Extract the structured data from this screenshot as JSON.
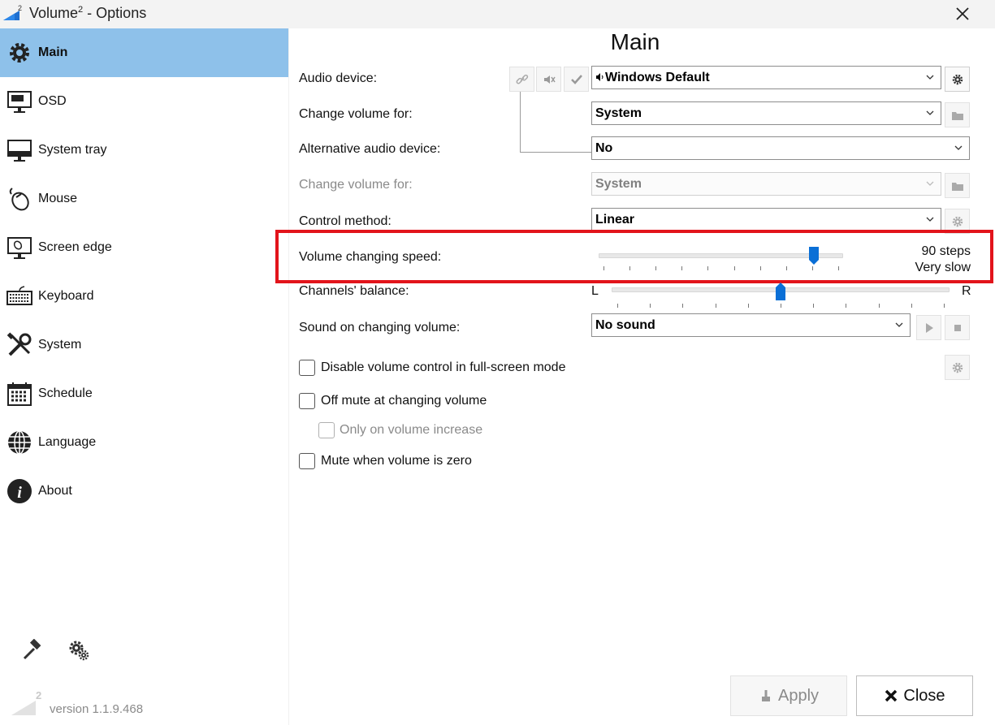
{
  "window": {
    "title": "Volume",
    "title_superscript": "2",
    "title_suffix": " - Options"
  },
  "sidebar": {
    "items": [
      {
        "label": "Main",
        "icon": "gear-icon",
        "active": true
      },
      {
        "label": "OSD",
        "icon": "monitor-icon"
      },
      {
        "label": "System tray",
        "icon": "system-tray-icon"
      },
      {
        "label": "Mouse",
        "icon": "mouse-icon"
      },
      {
        "label": "Screen edge",
        "icon": "screen-edge-icon"
      },
      {
        "label": "Keyboard",
        "icon": "keyboard-icon"
      },
      {
        "label": "System",
        "icon": "tools-icon"
      },
      {
        "label": "Schedule",
        "icon": "calendar-icon"
      },
      {
        "label": "Language",
        "icon": "globe-icon"
      },
      {
        "label": "About",
        "icon": "info-icon"
      }
    ],
    "version": "version 1.1.9.468"
  },
  "main": {
    "title": "Main",
    "audio_device": {
      "label": "Audio device:",
      "value": "Windows Default"
    },
    "change_volume_for": {
      "label": "Change volume for:",
      "value": "System"
    },
    "alt_audio_device": {
      "label": "Alternative audio device:",
      "value": "No"
    },
    "change_volume_for_alt": {
      "label": "Change volume for:",
      "value": "System"
    },
    "control_method": {
      "label": "Control method:",
      "value": "Linear"
    },
    "volume_speed": {
      "label": "Volume changing speed:",
      "steps": "90 steps",
      "speed_text": "Very slow",
      "position": 0.88
    },
    "balance": {
      "label": "Channels' balance:",
      "left": "L",
      "right": "R",
      "position": 0.5
    },
    "sound_on_change": {
      "label": "Sound on changing volume:",
      "value": "No sound"
    },
    "checkboxes": [
      {
        "label": "Disable volume control in full-screen mode",
        "checked": false,
        "enabled": true
      },
      {
        "label": "Off mute at changing volume",
        "checked": false,
        "enabled": true
      },
      {
        "label": "Only on volume increase",
        "checked": false,
        "enabled": false
      },
      {
        "label": "Mute when volume is zero",
        "checked": false,
        "enabled": true
      }
    ]
  },
  "footer": {
    "apply_label": "Apply",
    "close_label": "Close"
  },
  "colors": {
    "active_nav": "#8ec1ea",
    "slider_thumb": "#0a6fd6",
    "highlight": "#e2141b"
  }
}
